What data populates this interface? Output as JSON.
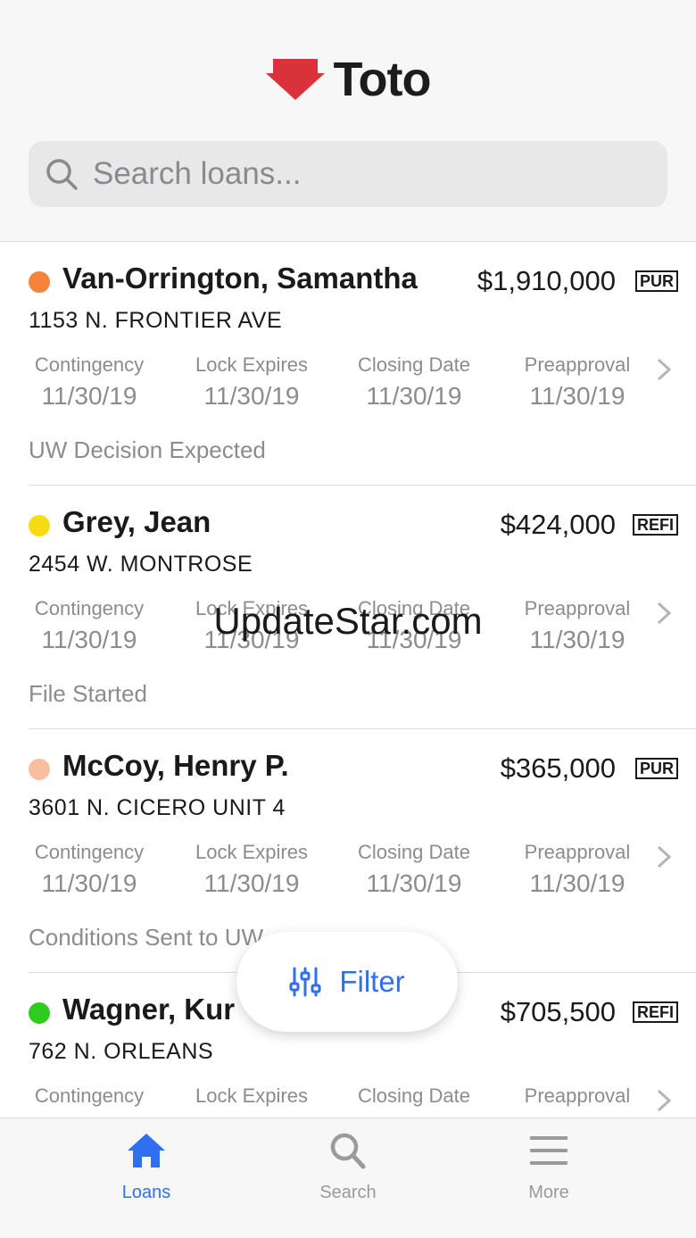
{
  "app": {
    "name": "Toto"
  },
  "search": {
    "placeholder": "Search loans..."
  },
  "loans": [
    {
      "name": "Van-Orrington, Samantha",
      "amount": "$1,910,000",
      "type": "PUR",
      "address": "1153 N. FRONTIER AVE",
      "status_color": "#f5843a",
      "dates": [
        {
          "label": "Contingency",
          "value": "11/30/19"
        },
        {
          "label": "Lock Expires",
          "value": "11/30/19"
        },
        {
          "label": "Closing Date",
          "value": "11/30/19"
        },
        {
          "label": "Preapproval",
          "value": "11/30/19"
        }
      ],
      "status": "UW Decision Expected"
    },
    {
      "name": "Grey, Jean",
      "amount": "$424,000",
      "type": "REFI",
      "address": "2454 W. MONTROSE",
      "status_color": "#f7dc13",
      "dates": [
        {
          "label": "Contingency",
          "value": "11/30/19"
        },
        {
          "label": "Lock Expires",
          "value": "11/30/19"
        },
        {
          "label": "Closing Date",
          "value": "11/30/19"
        },
        {
          "label": "Preapproval",
          "value": "11/30/19"
        }
      ],
      "status": "File Started"
    },
    {
      "name": "McCoy, Henry P.",
      "amount": "$365,000",
      "type": "PUR",
      "address": "3601 N. CICERO UNIT 4",
      "status_color": "#f7bfa0",
      "dates": [
        {
          "label": "Contingency",
          "value": "11/30/19"
        },
        {
          "label": "Lock Expires",
          "value": "11/30/19"
        },
        {
          "label": "Closing Date",
          "value": "11/30/19"
        },
        {
          "label": "Preapproval",
          "value": "11/30/19"
        }
      ],
      "status": "Conditions Sent to UW"
    },
    {
      "name": "Wagner, Kur",
      "amount": "$705,500",
      "type": "REFI",
      "address": "762 N. ORLEANS",
      "status_color": "#2ecc1f",
      "dates": [
        {
          "label": "Contingency",
          "value": ""
        },
        {
          "label": "Lock Expires",
          "value": ""
        },
        {
          "label": "Closing Date",
          "value": ""
        },
        {
          "label": "Preapproval",
          "value": ""
        }
      ],
      "status": ""
    }
  ],
  "watermark": "UpdateStar.com",
  "filter": {
    "label": "Filter"
  },
  "tabs": [
    {
      "label": "Loans",
      "icon": "home-icon",
      "active": true
    },
    {
      "label": "Search",
      "icon": "search-icon",
      "active": false
    },
    {
      "label": "More",
      "icon": "menu-icon",
      "active": false
    }
  ],
  "colors": {
    "accent": "#2f6ff0",
    "brand_red": "#d9323a",
    "muted": "#8c8c8c",
    "inactive_tab": "#9a9a9a"
  }
}
